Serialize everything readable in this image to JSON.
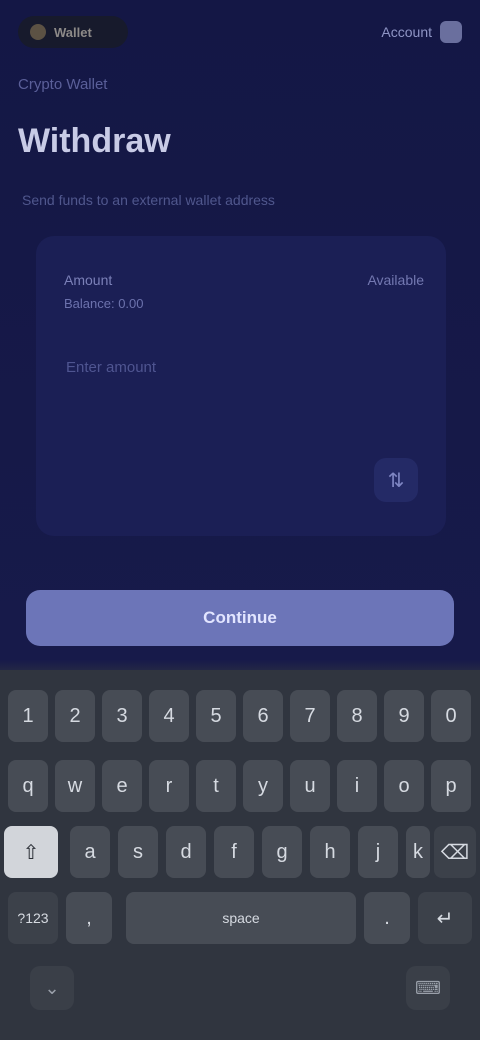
{
  "app": {
    "brand_label": "Wallet",
    "top_action_label": "Account"
  },
  "header": {
    "kicker": "Crypto Wallet",
    "title": "Withdraw",
    "subtitle": "Send funds to an external wallet address"
  },
  "card": {
    "asset_label": "Amount",
    "max_label": "Available",
    "balance_text": "Balance: 0.00",
    "amount_placeholder": "Enter amount"
  },
  "primary_button": {
    "label": "Continue"
  },
  "keyboard": {
    "row1": [
      "1",
      "2",
      "3",
      "4",
      "5",
      "6",
      "7",
      "8",
      "9",
      "0"
    ],
    "row2": [
      "q",
      "w",
      "e",
      "r",
      "t",
      "y",
      "u",
      "i",
      "o",
      "p"
    ],
    "row3": [
      "⇧",
      "a",
      "s",
      "d",
      "f",
      "g",
      "h",
      "j",
      "k",
      "⌫"
    ],
    "row4": [
      "?123",
      ",",
      "space",
      ".",
      "↵"
    ],
    "nav_left": "⌄",
    "nav_right": "⌨"
  }
}
